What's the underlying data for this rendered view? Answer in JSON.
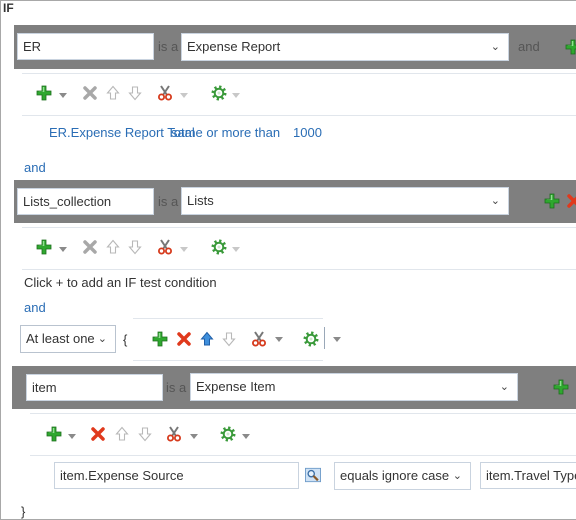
{
  "header": {
    "title": "IF"
  },
  "blocks": [
    {
      "variable": "ER",
      "is_a": "is a",
      "type": "Expense Report",
      "trailing": "and",
      "condition": {
        "left": "ER.Expense Report Total",
        "operator": "same or more than",
        "right": "1000"
      }
    },
    {
      "variable": "Lists_collection",
      "is_a": "is a",
      "type": "Lists",
      "hint": "Click + to add an IF test condition"
    },
    {
      "variable": "item",
      "is_a": "is a",
      "type": "Expense Item",
      "condition": {
        "left": "item.Expense Source",
        "operator": "equals ignore case",
        "right": "item.Travel Type"
      }
    }
  ],
  "connectors": [
    "and",
    "and"
  ],
  "quantifier": {
    "value": "At least one",
    "open_brace": "{",
    "close_brace": "}"
  },
  "icons": {
    "add": "plus-icon",
    "delete": "x-icon",
    "up": "arrow-up-icon",
    "down": "arrow-down-icon",
    "cut": "scissors-icon",
    "settings": "gear-icon",
    "search": "search-icon"
  },
  "colors": {
    "bar": "#7f7f7f",
    "link": "#2a6db5",
    "add": "#2fa82f",
    "delete": "#e0391c",
    "gear": "#3a9a3a"
  }
}
